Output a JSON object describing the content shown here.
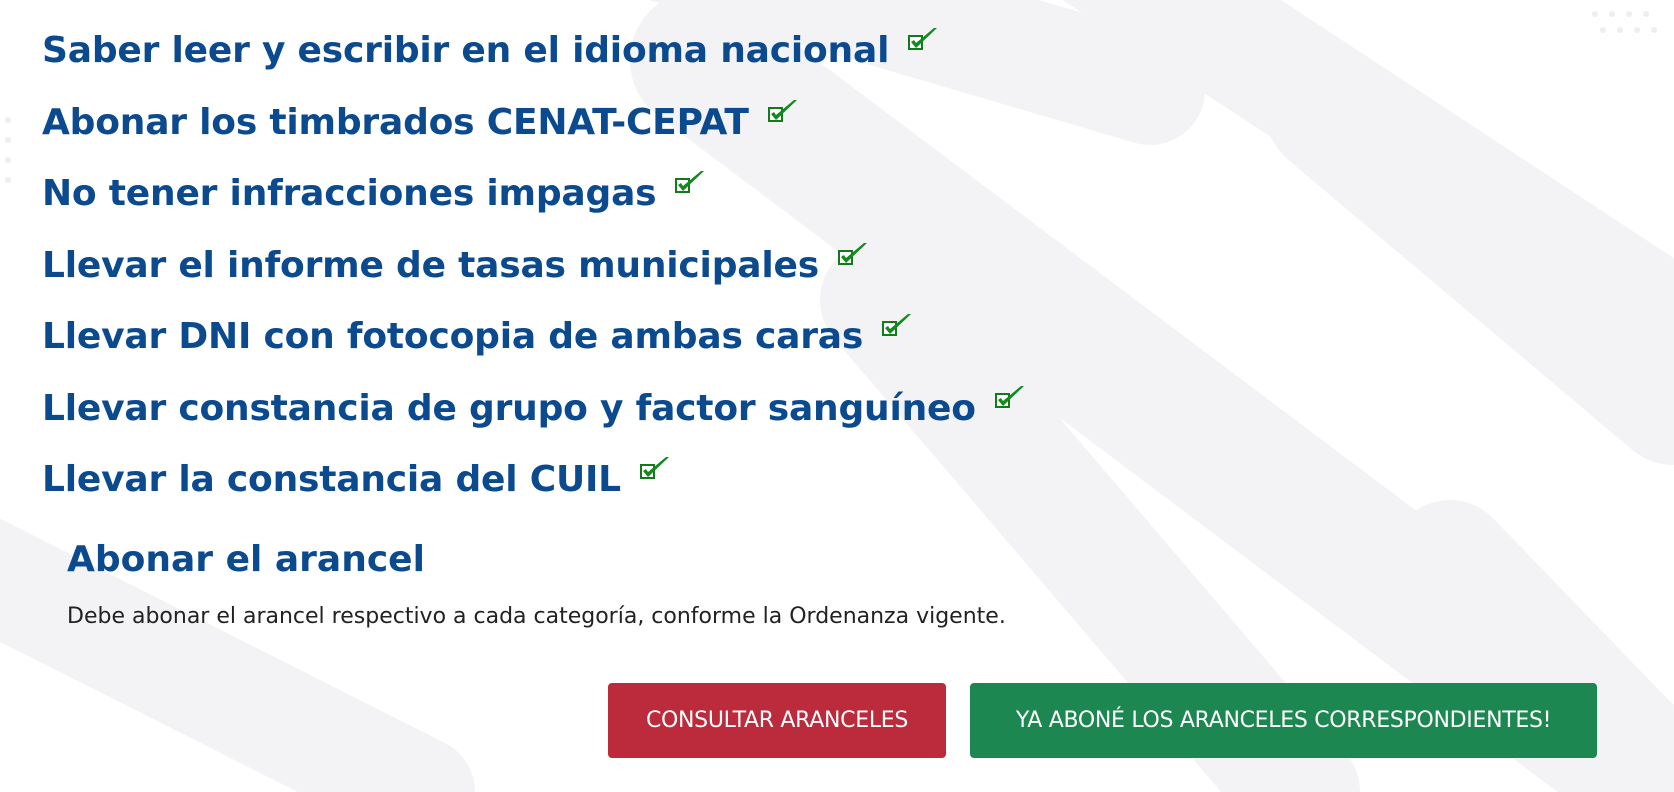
{
  "requirements": [
    "Saber leer y escribir en el idioma nacional",
    "Abonar los timbrados CENAT-CEPAT",
    "No tener infracciones impagas",
    "Llevar el informe de tasas municipales",
    "Llevar DNI con fotocopia de ambas caras",
    "Llevar constancia de grupo y factor sanguíneo",
    "Llevar la constancia del CUIL"
  ],
  "fee": {
    "title": "Abonar el arancel",
    "description": "Debe abonar el arancel respectivo a cada categoría, conforme la Ordenanza vigente."
  },
  "buttons": {
    "consult_label": "CONSULTAR ARANCELES",
    "paid_label": "YA ABONÉ LOS ARANCELES CORRESPONDIENTES!"
  },
  "colors": {
    "heading": "#0b4a8f",
    "check": "#138a1d",
    "consult_button": "#bb2b3c",
    "paid_button": "#1d8751"
  },
  "icons": {
    "requirement_marker": "check-icon"
  }
}
